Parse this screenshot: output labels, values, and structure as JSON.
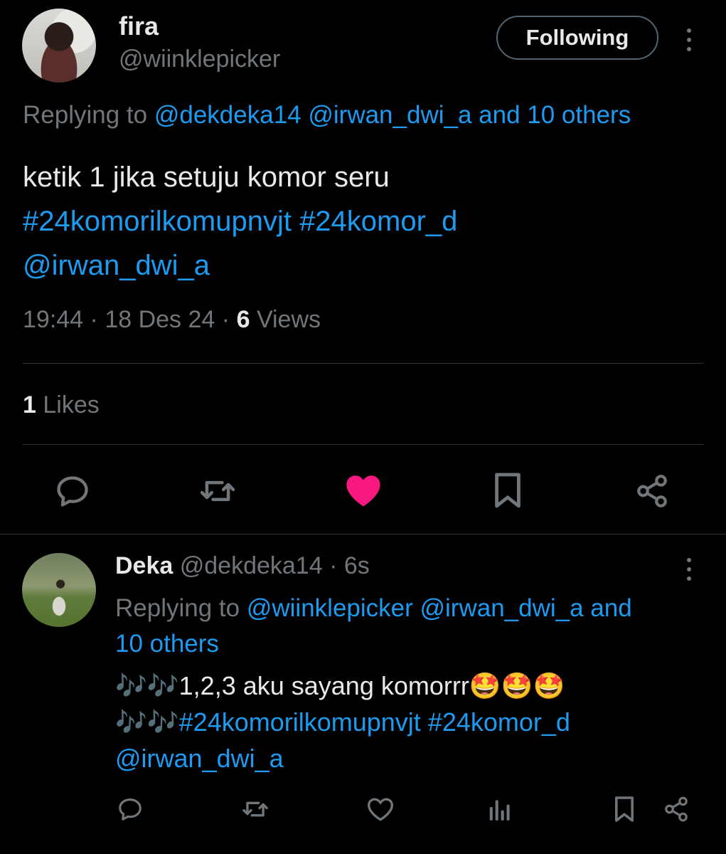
{
  "main_tweet": {
    "author_name": "fira",
    "author_handle": "@wiinklepicker",
    "follow_label": "Following",
    "replying_prefix": "Replying to",
    "replying_users": "@dekdeka14 @irwan_dwi_a and 10 others",
    "text_line1": "ketik 1 jika setuju komor seru",
    "text_line2": "#24komorilkomupnvjt #24komor_d",
    "text_line3": "@irwan_dwi_a",
    "time": "19:44",
    "date": "18 Des 24",
    "views_count": "6",
    "views_label": "Views",
    "likes_count": "1",
    "likes_label": "Likes",
    "liked": true
  },
  "reply_tweet": {
    "author_name": "Deka",
    "author_handle": "@dekdeka14",
    "age": "6s",
    "replying_prefix": "Replying to",
    "replying_users_line1": "@wiinklepicker @irwan_dwi_a and",
    "replying_users_line2": "10 others",
    "text_line1_prefix": "🎶🎶1,2,3 aku sayang komorrr",
    "text_line1_emoji": "🤩🤩🤩",
    "text_line2_prefix": "🎶🎶",
    "text_line2_tags": "#24komorilkomupnvjt #24komor_d",
    "text_line3": "@irwan_dwi_a"
  },
  "colors": {
    "background": "#000000",
    "text": "#e7e9ea",
    "muted": "#71767b",
    "link": "#1d9bf0",
    "like": "#f91880",
    "divider": "#2f3336"
  }
}
